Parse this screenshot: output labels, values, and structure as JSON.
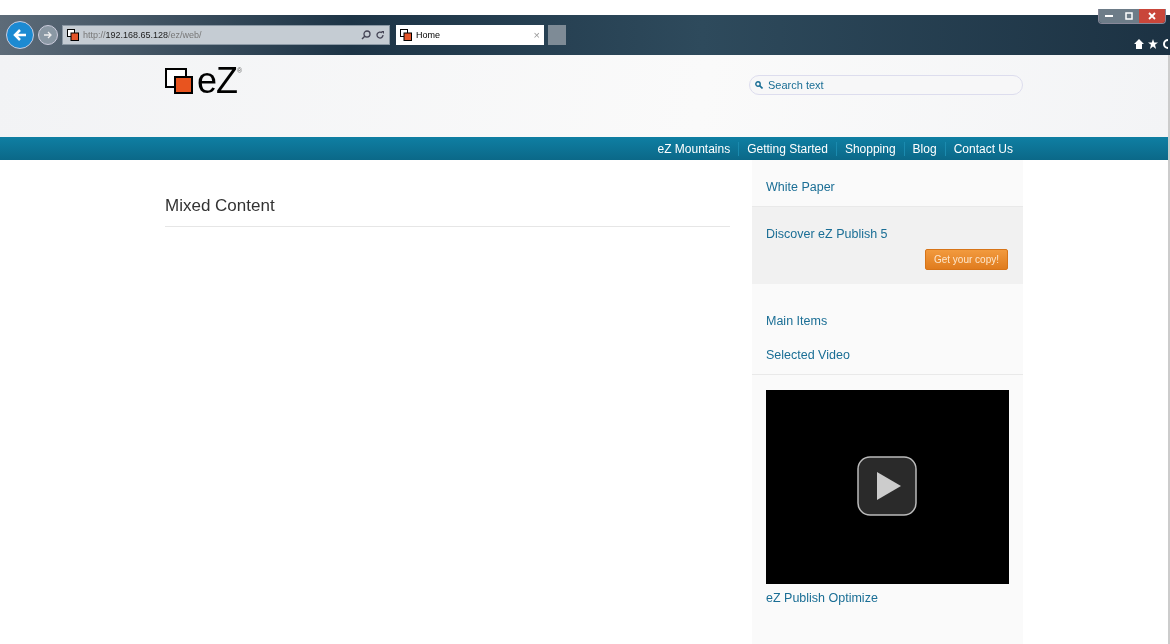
{
  "browser": {
    "address": "http://**192.168.65.128**/ez/web/",
    "tabs": [
      {
        "label": "Home",
        "selected": true,
        "close": "×"
      }
    ]
  },
  "site": {
    "logo": {
      "text": "eZ",
      "mark": "®"
    },
    "search": {
      "placeholder": "Search text"
    },
    "nav": [
      {
        "label": "eZ Mountains"
      },
      {
        "label": "Getting Started"
      },
      {
        "label": "Shopping"
      },
      {
        "label": "Blog"
      },
      {
        "label": "Contact Us"
      }
    ]
  },
  "main": {
    "title": "Mixed Content"
  },
  "sidebar": {
    "white_paper": {
      "title": "White Paper",
      "text": "Discover eZ Publish 5",
      "button": "Get your copy!"
    },
    "main_items": {
      "title": "Main Items"
    },
    "video": {
      "title": "Selected Video",
      "caption": "eZ Publish Optimize"
    }
  }
}
